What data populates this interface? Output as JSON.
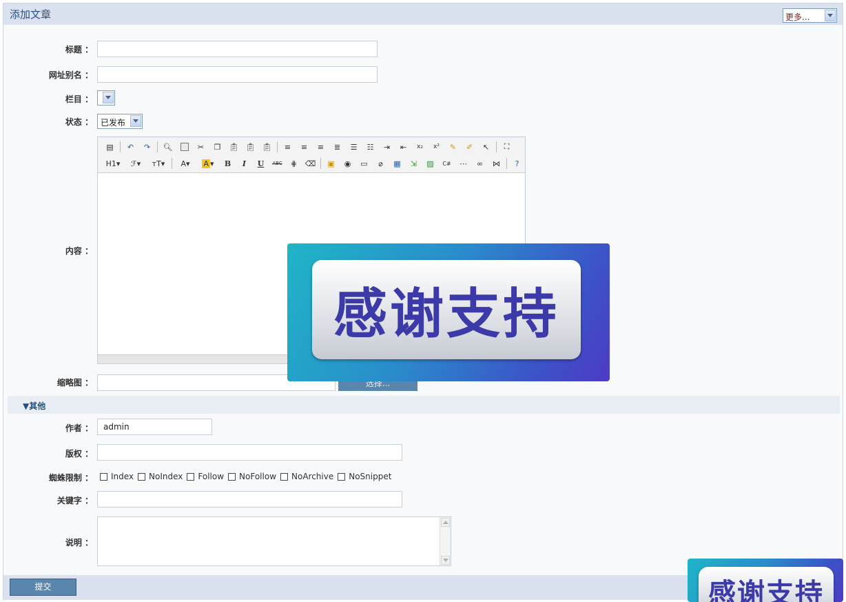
{
  "header": {
    "title": "添加文章",
    "more_select": "更多..."
  },
  "form": {
    "title_label": "标题 ：",
    "slug_label": "网址别名 ：",
    "category_label": "栏目 ：",
    "status_label": "状态 ：",
    "status_value": "已发布",
    "content_label": "内容 ：",
    "thumbnail_label": "缩略图 ：",
    "choose_button": "选择..."
  },
  "editor": {
    "toolbar_row1": [
      "source-icon",
      "undo-icon",
      "redo-icon",
      "preview-icon",
      "template-icon",
      "cut-icon",
      "copy-icon",
      "paste-icon",
      "paste-text-icon",
      "paste-word-icon",
      "align-left-icon",
      "align-center-icon",
      "align-right-icon",
      "align-justify-icon",
      "ordered-list-icon",
      "unordered-list-icon",
      "indent-icon",
      "outdent-icon",
      "subscript-icon",
      "superscript-icon",
      "clear-format-icon",
      "select-all-icon",
      "cursor-icon",
      "fullscreen-icon"
    ],
    "toolbar_row2_text": {
      "heading": "H1",
      "font": "ℱ",
      "size": "тT",
      "forecolor": "A",
      "bgcolor": "A",
      "bold": "B",
      "italic": "I",
      "underline": "U",
      "strike": "ABC"
    }
  },
  "other_section": {
    "toggle_label": "▼其他",
    "author_label": "作者 ：",
    "author_value": "admin",
    "copyright_label": "版权 ：",
    "spider_label": "蜘蛛限制 ：",
    "spider_options": [
      "Index",
      "NoIndex",
      "Follow",
      "NoFollow",
      "NoArchive",
      "NoSnippet"
    ],
    "keywords_label": "关键字 ：",
    "description_label": "说明 ："
  },
  "footer": {
    "submit_label": "提交"
  },
  "overlay": {
    "ad_text": "感谢支持"
  },
  "colors": {
    "header_bg": "#d9e2ee",
    "button_bg": "#5a86ad",
    "title_color": "#2c4f80",
    "ad_text": "#3b3aa8"
  }
}
